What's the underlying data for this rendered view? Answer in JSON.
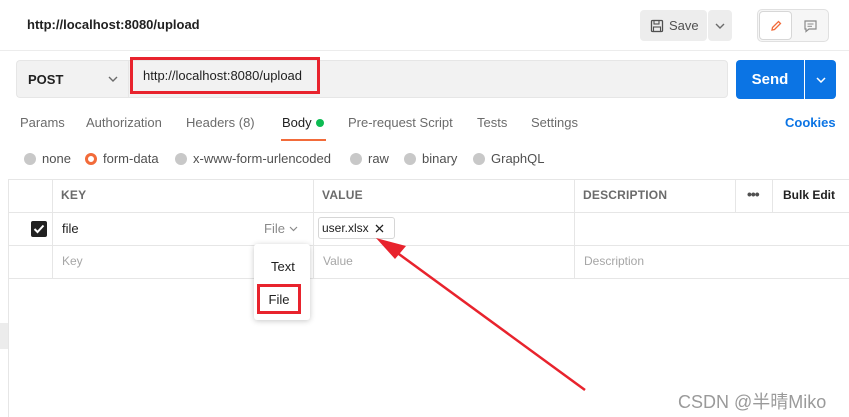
{
  "header": {
    "request_title": "http://localhost:8080/upload",
    "save_label": "Save",
    "icons": [
      "save-icon",
      "chevron-down-icon",
      "pencil-icon",
      "comment-icon"
    ]
  },
  "request": {
    "method": "POST",
    "url": "http://localhost:8080/upload",
    "send_label": "Send"
  },
  "tabs": [
    {
      "label": "Params"
    },
    {
      "label": "Authorization"
    },
    {
      "label": "Headers (8)"
    },
    {
      "label": "Body"
    },
    {
      "label": "Pre-request Script"
    },
    {
      "label": "Tests"
    },
    {
      "label": "Settings"
    }
  ],
  "active_tab": "Body",
  "cookies_label": "Cookies",
  "body_types": [
    {
      "label": "none",
      "selected": false
    },
    {
      "label": "form-data",
      "selected": true
    },
    {
      "label": "x-www-form-urlencoded",
      "selected": false
    },
    {
      "label": "raw",
      "selected": false
    },
    {
      "label": "binary",
      "selected": false
    },
    {
      "label": "GraphQL",
      "selected": false
    }
  ],
  "table": {
    "headers": {
      "key": "KEY",
      "value": "VALUE",
      "description": "DESCRIPTION",
      "more": "•••",
      "bulk_edit": "Bulk Edit"
    },
    "row": {
      "checked": true,
      "key": "file",
      "type_label": "File",
      "file_name": "user.xlsx"
    },
    "placeholders": {
      "key": "Key",
      "value": "Value",
      "description": "Description"
    }
  },
  "type_dropdown": {
    "options": [
      "Text",
      "File"
    ],
    "highlighted": "File"
  },
  "watermark": "CSDN @半晴Miko",
  "colors": {
    "accent": "#f26b3a",
    "send": "#0b74e4",
    "annotation": "#e8232d",
    "body_dot": "#0cbb52"
  }
}
